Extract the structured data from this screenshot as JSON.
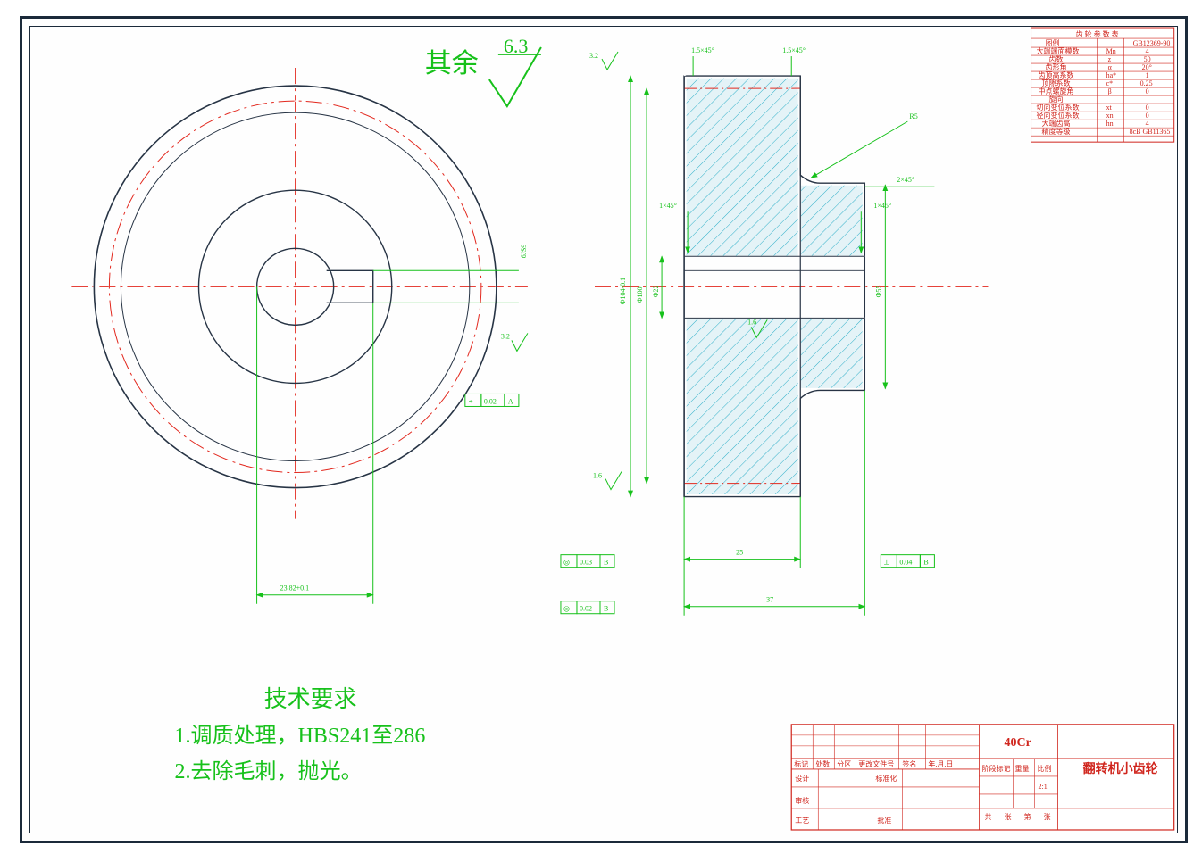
{
  "surface_default_label": "其余",
  "surface_default_value": "6.3",
  "surface_marks": {
    "sm1": "3.2",
    "sm2": "3.2",
    "sm3": "1.6",
    "sm4": "1.6",
    "keyway_note": "6JS9"
  },
  "dimensions": {
    "chamfer_top_left": "1.5×45°",
    "chamfer_top_right": "1.5×45°",
    "fillet": "R5",
    "chamfer_hub_right": "2×45°",
    "chamfer_bore_left": "1×45°",
    "chamfer_bore_right": "1×45°",
    "dia_outer": "Φ104-0.1",
    "dia_root": "Φ100",
    "dia_bore": "Φ22",
    "dia_hub": "Φ55",
    "len_face": "25",
    "len_total": "37",
    "keyway_width": "23.82+0.1"
  },
  "gdt": {
    "fcf1_sym": "⌖",
    "fcf1_val": "0.02",
    "fcf1_datum": "A",
    "fcf2_sym": "◎",
    "fcf2_val": "0.03",
    "fcf2_datum": "B",
    "fcf3_sym": "◎",
    "fcf3_val": "0.02",
    "fcf3_datum": "B",
    "fcf4_sym": "⊥",
    "fcf4_val": "0.04",
    "fcf4_datum": "B"
  },
  "tech_req": {
    "title": "技术要求",
    "line1": "1.调质处理，HBS241至286",
    "line2": "2.去除毛刺，抛光。"
  },
  "gear_table": {
    "title": "齿  轮  参  数  表",
    "rows": [
      [
        "图例",
        "",
        "GB12369-90"
      ],
      [
        "大端端面模数",
        "Mn",
        "4"
      ],
      [
        "齿数",
        "z",
        "50"
      ],
      [
        "齿形角",
        "α",
        "20°"
      ],
      [
        "齿顶高系数",
        "ha*",
        "1"
      ],
      [
        "顶隙系数",
        "c*",
        "0.25"
      ],
      [
        "中点螺旋角",
        "β",
        "0"
      ],
      [
        "旋向",
        "",
        ""
      ],
      [
        "切向变位系数",
        "xt",
        "0"
      ],
      [
        "径向变位系数",
        "xn",
        "0"
      ],
      [
        "大端齿高",
        "hn",
        "4"
      ],
      [
        "精度等级",
        "",
        "8cB GB11365"
      ]
    ]
  },
  "title_block": {
    "material": "40Cr",
    "part_name": "翻转机小齿轮",
    "scale": "2:1",
    "labels": {
      "biaoji": "标记",
      "chushu": "处数",
      "fenqu": "分区",
      "gengai": "更改文件号",
      "qianming": "签名",
      "riqi": "年.月.日",
      "sheji": "设计",
      "biaozhunhua": "标准化",
      "shenhe": "审核",
      "gongyi": "工艺",
      "pizhun": "批准",
      "jieduan": "阶段标记",
      "zhongliang": "重量",
      "bili": "比例",
      "gong": "共",
      "zhang": "张",
      "di": "第",
      "zhang2": "张"
    }
  }
}
